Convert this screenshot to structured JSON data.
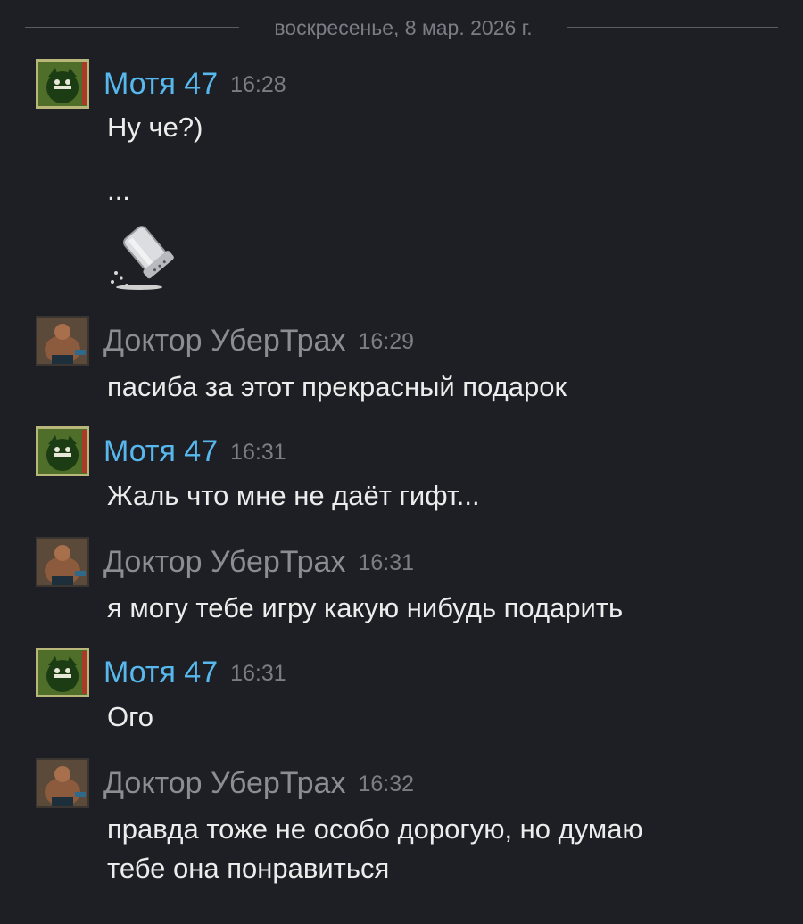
{
  "date_separator": "воскресенье, 8 мар. 2026 г.",
  "messages": [
    {
      "author": "Мотя 47",
      "time": "16:28",
      "lines": [
        "Ну че?)",
        "..."
      ],
      "sticker": "salt-shaker-emoji"
    },
    {
      "author": "Доктор УберТрах",
      "time": "16:29",
      "lines": [
        "пасиба за этот прекрасный подарок"
      ]
    },
    {
      "author": "Мотя 47",
      "time": "16:31",
      "lines": [
        "Жаль что мне не даёт гифт..."
      ]
    },
    {
      "author": "Доктор УберТрах",
      "time": "16:31",
      "lines": [
        "я могу тебе игру какую нибудь подарить"
      ]
    },
    {
      "author": "Мотя 47",
      "time": "16:31",
      "lines": [
        "Ого"
      ]
    },
    {
      "author": "Доктор УберТрах",
      "time": "16:32",
      "lines": [
        "правда тоже не особо дорогую, но думаю",
        "тебе она понравиться"
      ]
    }
  ],
  "colors": {
    "background": "#1e1f24",
    "moty_name": "#57b8ee",
    "doctor_name": "#8b8d93",
    "timestamp": "#7b7d85",
    "text": "#ececec"
  }
}
